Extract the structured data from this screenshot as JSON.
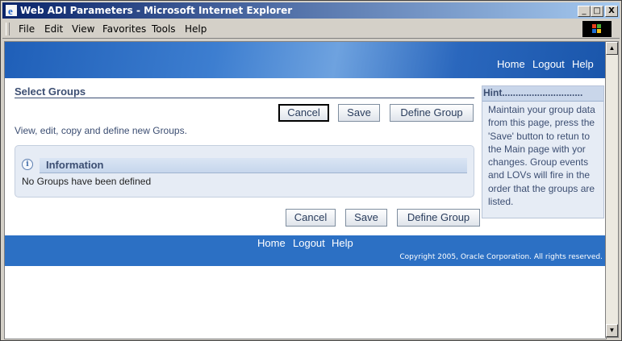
{
  "window": {
    "title": "Web ADI Parameters - Microsoft Internet Explorer",
    "controls": {
      "minimize": "_",
      "maximize": "□",
      "close": "X"
    }
  },
  "menu": {
    "items": [
      "File",
      "Edit",
      "View",
      "Favorites",
      "Tools",
      "Help"
    ]
  },
  "header": {
    "links": [
      "Home",
      "Logout",
      "Help"
    ]
  },
  "page": {
    "title": "Select Groups",
    "description": "View, edit, copy and define new Groups.",
    "buttons": {
      "cancel": "Cancel",
      "save": "Save",
      "define_group": "Define Group"
    }
  },
  "info": {
    "icon": "i",
    "title": "Information",
    "message": "No Groups have been defined"
  },
  "hint": {
    "title": "Hint..............................",
    "text": "Maintain your group data from this page, press the 'Save' button to retun to the Main page with yor changes. Group events and LOVs will fire in the order that the groups are listed."
  },
  "footer": {
    "links": [
      "Home",
      "Logout",
      "Help"
    ],
    "copyright": "Copyright 2005, Oracle Corporation. All rights reserved."
  },
  "colors": {
    "titlebar_start": "#0a246a",
    "banner_blue": "#2c70c4",
    "heading_text": "#3c4e72"
  }
}
